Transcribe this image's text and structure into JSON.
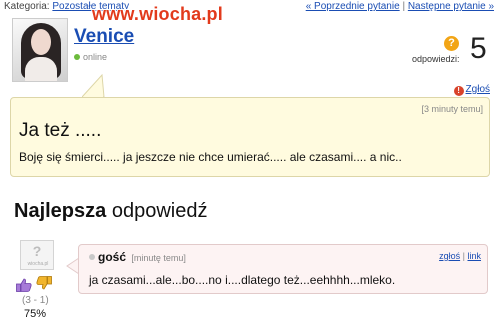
{
  "topbar": {
    "category_label": "Kategoria:",
    "category_link": "Pozostałe tematy",
    "prev_link": "« Poprzednie pytanie",
    "separator": "|",
    "next_link": "Następne pytanie »"
  },
  "watermark": "www.wiocha.pl",
  "user": {
    "name": "Venice",
    "status": "online"
  },
  "answers": {
    "icon": "question-icon",
    "label": "odpowiedzi:",
    "count": "5"
  },
  "report_top": {
    "icon": "report-icon",
    "label": "Zgłoś"
  },
  "question": {
    "time": "[3 minuty temu]",
    "title": "Ja też .....",
    "body": "Boję się śmierci..... ja jeszcze nie chce umierać..... ale czasami.... a nic.."
  },
  "best": {
    "heading_bold": "Najlepsza",
    "heading_rest": " odpowiedź"
  },
  "answer": {
    "avatar_label": "wiocha.pl",
    "user": "gość",
    "time": "[minutę temu]",
    "report_link": "zgłoś",
    "link_link": "link",
    "links_separator": "|",
    "body": "ja czasami...ale...bo....no i....dlatego też...eehhhh...mleko.",
    "votes": "(3 - 1)",
    "percent": "75%"
  },
  "colors": {
    "link": "#1a4db3",
    "watermark": "#e23a1c",
    "question_bg": "#fffbdf",
    "answer_bg": "#fdf3f3",
    "online": "#6cbb3c",
    "badge": "#f2a516"
  }
}
